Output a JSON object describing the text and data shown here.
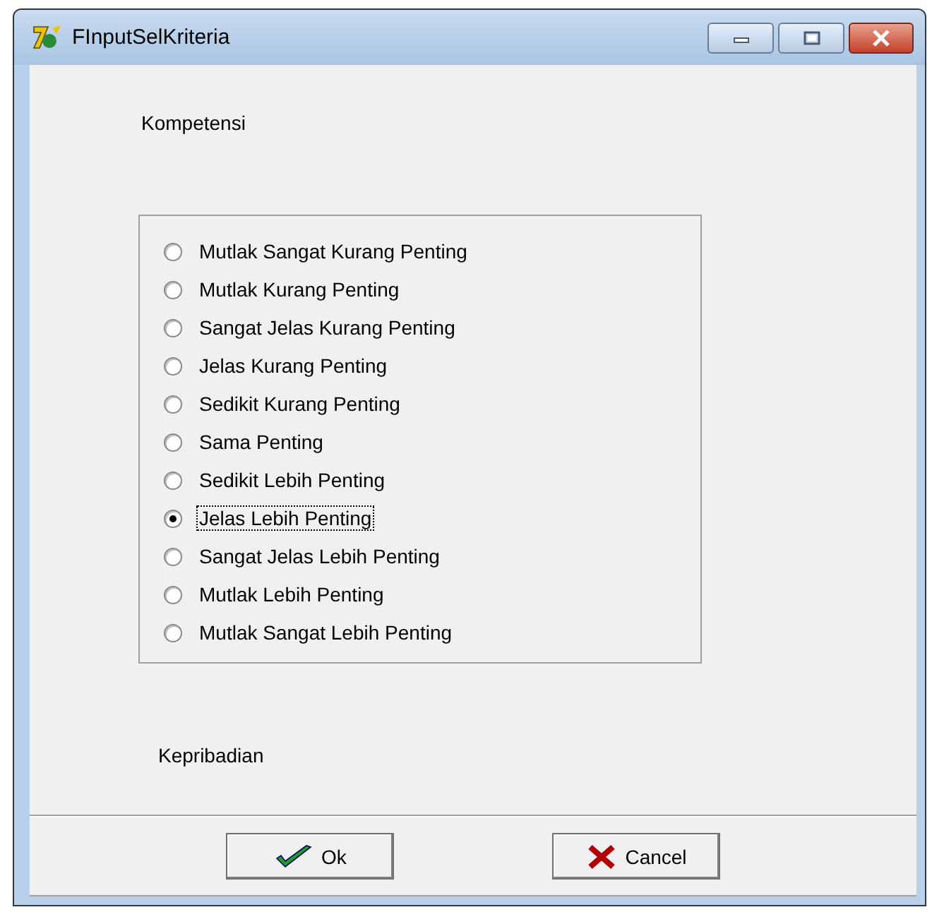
{
  "window": {
    "title": "FInputSelKriteria"
  },
  "criterion_a": "Kompetensi",
  "options": [
    {
      "label": "Mutlak Sangat Kurang Penting",
      "selected": false
    },
    {
      "label": "Mutlak Kurang Penting",
      "selected": false
    },
    {
      "label": "Sangat Jelas Kurang Penting",
      "selected": false
    },
    {
      "label": "Jelas Kurang Penting",
      "selected": false
    },
    {
      "label": "Sedikit Kurang Penting",
      "selected": false
    },
    {
      "label": "Sama Penting",
      "selected": false
    },
    {
      "label": "Sedikit Lebih Penting",
      "selected": false
    },
    {
      "label": "Jelas Lebih Penting",
      "selected": true
    },
    {
      "label": "Sangat Jelas Lebih Penting",
      "selected": false
    },
    {
      "label": "Mutlak Lebih Penting",
      "selected": false
    },
    {
      "label": "Mutlak Sangat Lebih Penting",
      "selected": false
    }
  ],
  "criterion_b": "Kepribadian",
  "buttons": [
    {
      "label": "Ok",
      "kind": "ok"
    },
    {
      "label": "Cancel",
      "kind": "cancel"
    }
  ]
}
